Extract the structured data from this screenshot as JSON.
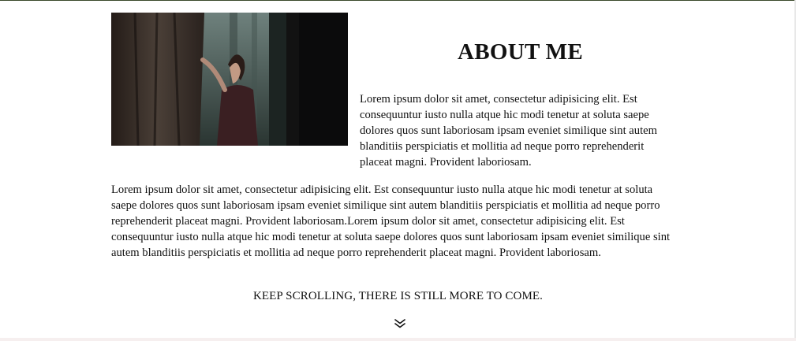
{
  "about": {
    "heading": "ABOUT ME",
    "side_paragraph": "Lorem ipsum dolor sit amet, consectetur adipisicing elit. Est consequuntur iusto nulla atque hic modi tenetur at soluta saepe dolores quos sunt laboriosam ipsam eveniet similique sint autem blanditiis perspiciatis et mollitia ad neque porro reprehenderit placeat magni. Provident laboriosam.",
    "body_paragraph": "Lorem ipsum dolor sit amet, consectetur adipisicing elit. Est consequuntur iusto nulla atque hic modi tenetur at soluta saepe dolores quos sunt laboriosam ipsam eveniet similique sint autem blanditiis perspiciatis et mollitia ad neque porro reprehenderit placeat magni. Provident laboriosam.Lorem ipsum dolor sit amet, consectetur adipisicing elit. Est consequuntur iusto nulla atque hic modi tenetur at soluta saepe dolores quos sunt laboriosam ipsam eveniet similique sint autem blanditiis perspiciatis et mollitia ad neque porro reprehenderit placeat magni. Provident laboriosam."
  },
  "scroll": {
    "hint_text": "KEEP SCROLLING, THERE IS STILL MORE TO COME.",
    "icon": "double-chevron-down-icon"
  }
}
